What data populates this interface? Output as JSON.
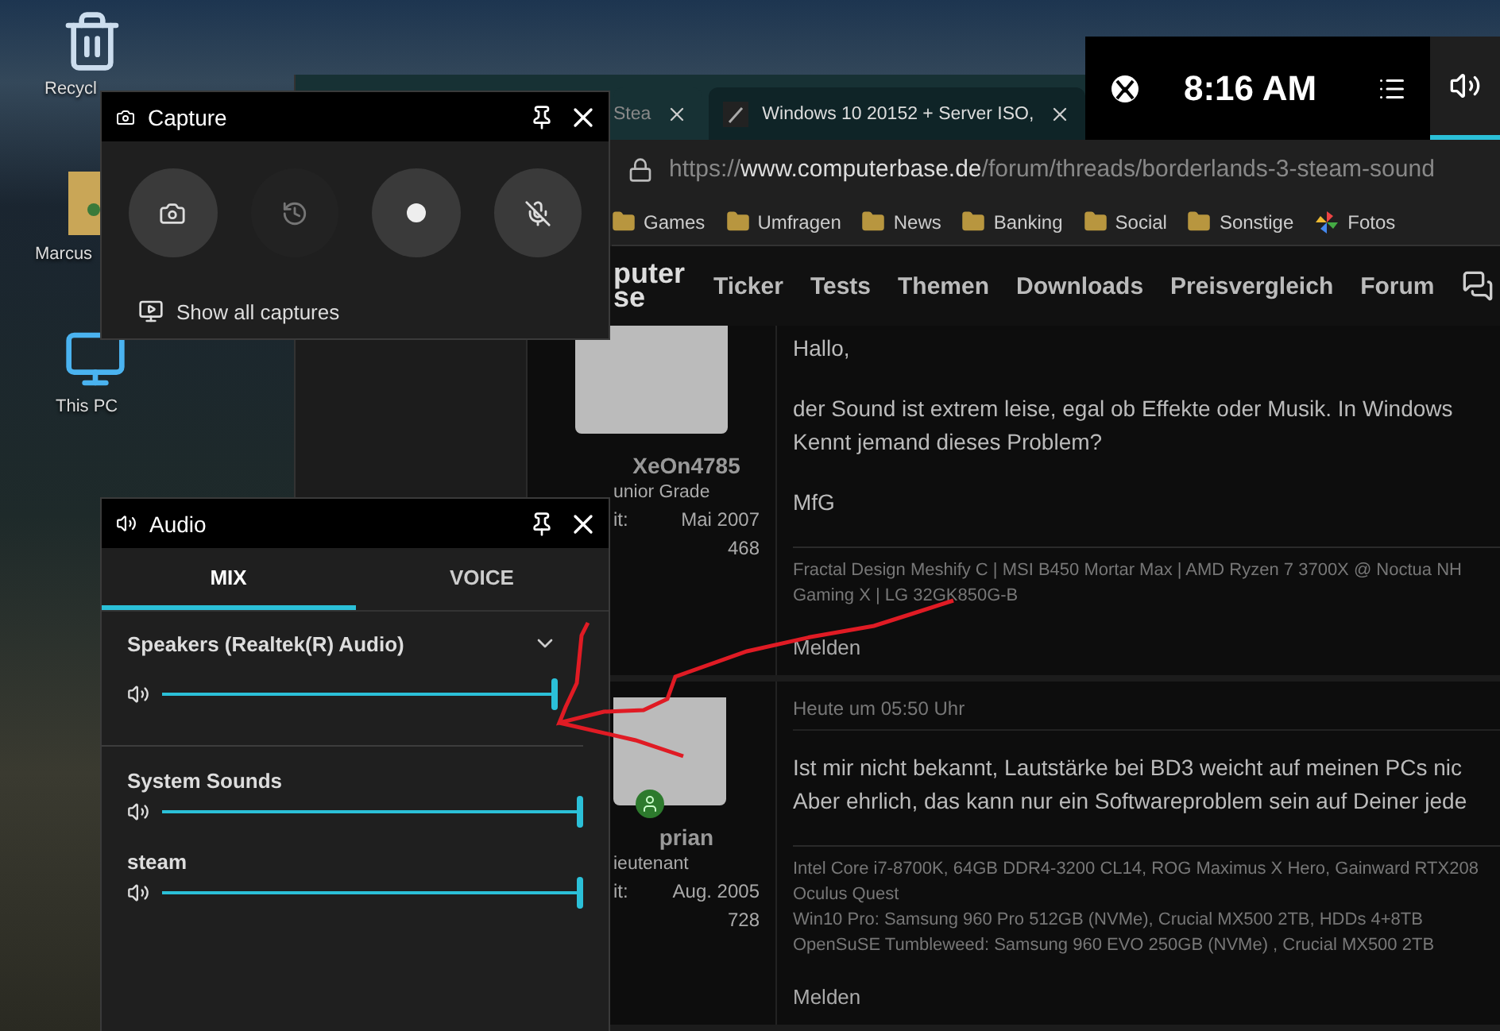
{
  "desktop": {
    "icons": [
      {
        "label": "Recycl",
        "kind": "bin"
      },
      {
        "label": "Marcus",
        "kind": "user"
      },
      {
        "label": "This PC",
        "kind": "pc"
      }
    ]
  },
  "browser": {
    "tabs": [
      {
        "label": "Stea",
        "selected": false
      },
      {
        "label": "Windows 10 20152 + Server ISO,",
        "selected": true
      }
    ],
    "url": {
      "scheme": "https://",
      "host": "www.computerbase.de",
      "path": "/forum/threads/borderlands-3-steam-sound"
    },
    "bookmarks": [
      {
        "label": "Games",
        "kind": "folder"
      },
      {
        "label": "Umfragen",
        "kind": "folder"
      },
      {
        "label": "News",
        "kind": "folder"
      },
      {
        "label": "Banking",
        "kind": "folder"
      },
      {
        "label": "Social",
        "kind": "folder"
      },
      {
        "label": "Sonstige",
        "kind": "folder"
      },
      {
        "label": "Fotos",
        "kind": "photos"
      }
    ],
    "site": {
      "logo": [
        "puter",
        "se"
      ],
      "nav": [
        "Ticker",
        "Tests",
        "Themen",
        "Downloads",
        "Preisvergleich",
        "Forum"
      ]
    },
    "posts": [
      {
        "user": "XeOn4785",
        "rank": "unior Grade",
        "joined_label": "it:",
        "joined": "Mai 2007",
        "count": "468",
        "online": false,
        "paragraphs": [
          "Hallo,",
          "der Sound ist extrem leise, egal ob Effekte oder Musik. In Windows\nKennt jemand dieses Problem?",
          "MfG"
        ],
        "signature": [
          "Fractal Design Meshify C | MSI B450 Mortar Max | AMD Ryzen 7 3700X @ Noctua NH",
          "Gaming X | LG 32GK850G-B"
        ],
        "report": "Melden"
      },
      {
        "user": "prian",
        "rank": "ieutenant",
        "joined_label": "it:",
        "joined": "Aug. 2005",
        "count": "728",
        "online": true,
        "date": "Heute um 05:50 Uhr",
        "paragraphs": [
          "Ist mir nicht bekannt, Lautstärke bei BD3 weicht auf meinen PCs nic\nAber ehrlich, das kann nur ein Softwareproblem sein auf Deiner jede"
        ],
        "signature": [
          "Intel Core i7-8700K, 64GB DDR4-3200 CL14, ROG Maximus X Hero, Gainward RTX208",
          "Oculus Quest",
          "Win10 Pro: Samsung 960 Pro 512GB (NVMe), Crucial MX500 2TB, HDDs 4+8TB",
          "OpenSuSE Tumbleweed: Samsung 960 EVO 250GB (NVMe) , Crucial MX500 2TB"
        ],
        "report": "Melden"
      }
    ]
  },
  "game_bar": {
    "time": "8:16 AM"
  },
  "capture_widget": {
    "title": "Capture",
    "buttons": [
      {
        "kind": "screenshot",
        "disabled": false
      },
      {
        "kind": "record-last",
        "disabled": true
      },
      {
        "kind": "record",
        "disabled": false
      },
      {
        "kind": "mic",
        "disabled": false
      }
    ],
    "show_all": "Show all captures"
  },
  "audio_widget": {
    "title": "Audio",
    "tabs": [
      {
        "label": "MIX",
        "selected": true
      },
      {
        "label": "VOICE",
        "selected": false
      }
    ],
    "channels": [
      {
        "name": "Speakers (Realtek(R) Audio)",
        "kind": "device",
        "level": 1.0
      },
      {
        "name": "System Sounds",
        "kind": "app",
        "level": 1.0
      },
      {
        "name": "steam",
        "kind": "app",
        "level": 1.0
      }
    ]
  }
}
